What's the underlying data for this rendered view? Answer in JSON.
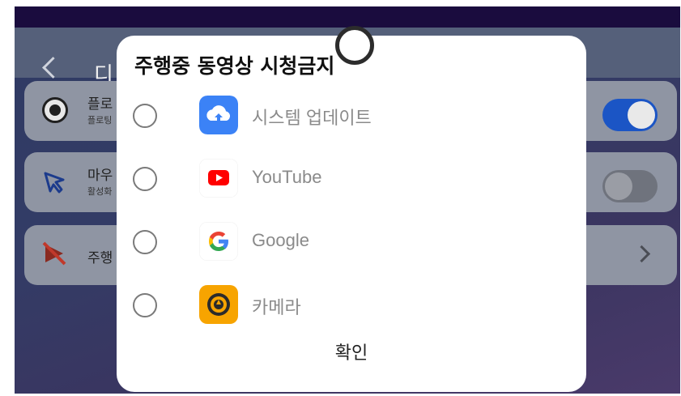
{
  "background": {
    "page_title": "디",
    "cards": [
      {
        "title": "플로",
        "subtitle": "플로팅",
        "control": "toggle-on"
      },
      {
        "title": "마우",
        "subtitle": "활성화",
        "control": "toggle-off"
      },
      {
        "title": "주행",
        "subtitle": "",
        "control": "chevron"
      }
    ]
  },
  "dialog": {
    "title": "주행중 동영상 시청금지",
    "options": [
      {
        "label": "시스템 업데이트",
        "icon": "system-update-icon",
        "selected": false
      },
      {
        "label": "YouTube",
        "icon": "youtube-icon",
        "selected": false
      },
      {
        "label": "Google",
        "icon": "google-icon",
        "selected": false
      },
      {
        "label": "카메라",
        "icon": "camera-icon",
        "selected": false
      }
    ],
    "confirm_label": "확인"
  },
  "colors": {
    "toggle_on": "#1b55c5",
    "youtube_red": "#ff0000",
    "camera_orange": "#f7a400",
    "update_blue": "#3b82f6"
  }
}
